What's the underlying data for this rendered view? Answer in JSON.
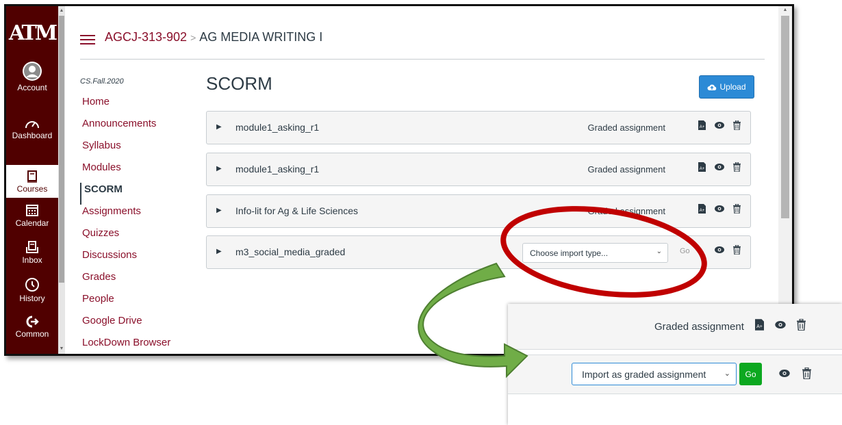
{
  "left_nav": {
    "logo": "ATM",
    "items": [
      {
        "label": "Account",
        "icon": "account-icon"
      },
      {
        "label": "Dashboard",
        "icon": "dashboard-icon"
      },
      {
        "label": "Courses",
        "icon": "courses-icon"
      },
      {
        "label": "Calendar",
        "icon": "calendar-icon"
      },
      {
        "label": "Inbox",
        "icon": "inbox-icon"
      },
      {
        "label": "History",
        "icon": "history-icon"
      },
      {
        "label": "Common",
        "icon": "commons-icon"
      }
    ]
  },
  "breadcrumb": {
    "course_code": "AGCJ-313-902",
    "separator": ">",
    "current": "AG MEDIA WRITING I"
  },
  "course_nav": {
    "term": "CS.Fall.2020",
    "links": [
      "Home",
      "Announcements",
      "Syllabus",
      "Modules",
      "SCORM",
      "Assignments",
      "Quizzes",
      "Discussions",
      "Grades",
      "People",
      "Google Drive",
      "LockDown Browser"
    ],
    "active": "SCORM"
  },
  "page": {
    "title": "SCORM",
    "upload_label": "Upload"
  },
  "packages": [
    {
      "name": "module1_asking_r1",
      "status": "Graded assignment"
    },
    {
      "name": "module1_asking_r1",
      "status": "Graded assignment"
    },
    {
      "name": "Info-lit for Ag & Life Sciences",
      "status": "Graded assignment"
    },
    {
      "name": "m3_social_media_graded",
      "select_value": "Choose import type...",
      "go_label": "Go"
    }
  ],
  "inset": {
    "status": "Graded assignment",
    "select_value": "Import as graded assignment",
    "go_label": "Go"
  },
  "colors": {
    "brand_maroon": "#500000",
    "link": "#8a0f2a",
    "upload_blue": "#2c8ad6",
    "go_green": "#0ca820",
    "annotation_circle": "#c00000",
    "annotation_arrow": "#70ad47"
  }
}
